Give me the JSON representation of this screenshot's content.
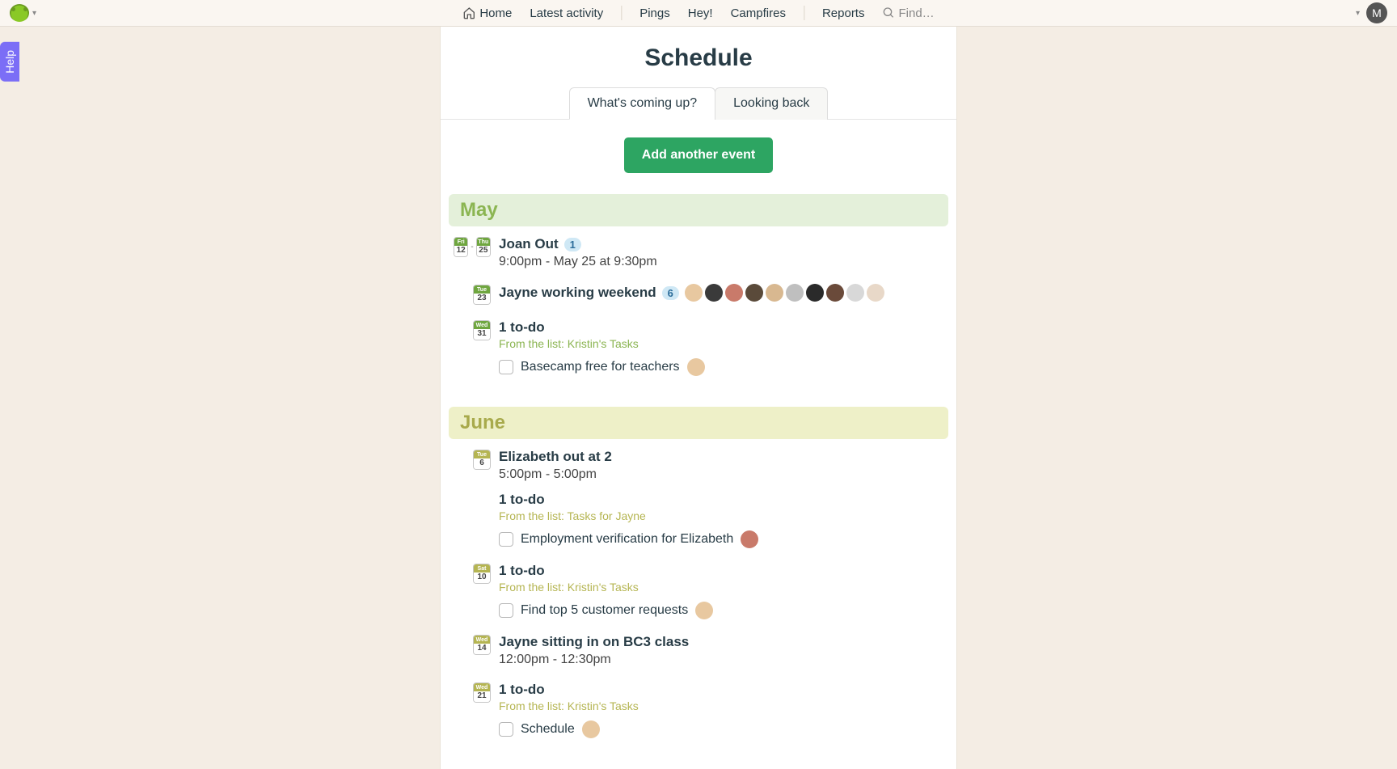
{
  "nav": {
    "home": "Home",
    "latest": "Latest activity",
    "pings": "Pings",
    "hey": "Hey!",
    "campfires": "Campfires",
    "reports": "Reports",
    "find": "Find…"
  },
  "user_initial": "M",
  "help_label": "Help",
  "page_title": "Schedule",
  "tabs": {
    "upcoming": "What's coming up?",
    "past": "Looking back"
  },
  "add_event": "Add another event",
  "months": {
    "may": "May",
    "june": "June"
  },
  "may_events": {
    "joan": {
      "date1_dow": "Fri",
      "date1_num": "12",
      "date2_dow": "Thu",
      "date2_num": "25",
      "title": "Joan Out",
      "count": "1",
      "time": "9:00pm - May 25 at 9:30pm"
    },
    "jayne": {
      "date_dow": "Tue",
      "date_num": "23",
      "title": "Jayne working weekend",
      "count": "6"
    },
    "todo31": {
      "date_dow": "Wed",
      "date_num": "31",
      "title": "1 to-do",
      "from": "From the list: Kristin's Tasks",
      "task": "Basecamp free for teachers"
    }
  },
  "june_events": {
    "eliz": {
      "date_dow": "Tue",
      "date_num": "6",
      "title": "Elizabeth out at 2",
      "time": "5:00pm - 5:00pm"
    },
    "todo6": {
      "title": "1 to-do",
      "from": "From the list: Tasks for Jayne",
      "task": "Employment verification for Elizabeth"
    },
    "todo10": {
      "date_dow": "Sat",
      "date_num": "10",
      "title": "1 to-do",
      "from": "From the list: Kristin's Tasks",
      "task": "Find top 5 customer requests"
    },
    "jayne_bc3": {
      "date_dow": "Wed",
      "date_num": "14",
      "title": "Jayne sitting in on BC3 class",
      "time": "12:00pm - 12:30pm"
    },
    "todo21": {
      "date_dow": "Wed",
      "date_num": "21",
      "title": "1 to-do",
      "from": "From the list: Kristin's Tasks",
      "task": "Schedule"
    }
  },
  "avatar_colors": [
    "#e8c8a0",
    "#3a3a3a",
    "#c97a6a",
    "#5a4a3a",
    "#d8b890",
    "#bfbfbf",
    "#2a2a2a",
    "#6a4a3a",
    "#d8d8d8",
    "#e8d8c8"
  ]
}
